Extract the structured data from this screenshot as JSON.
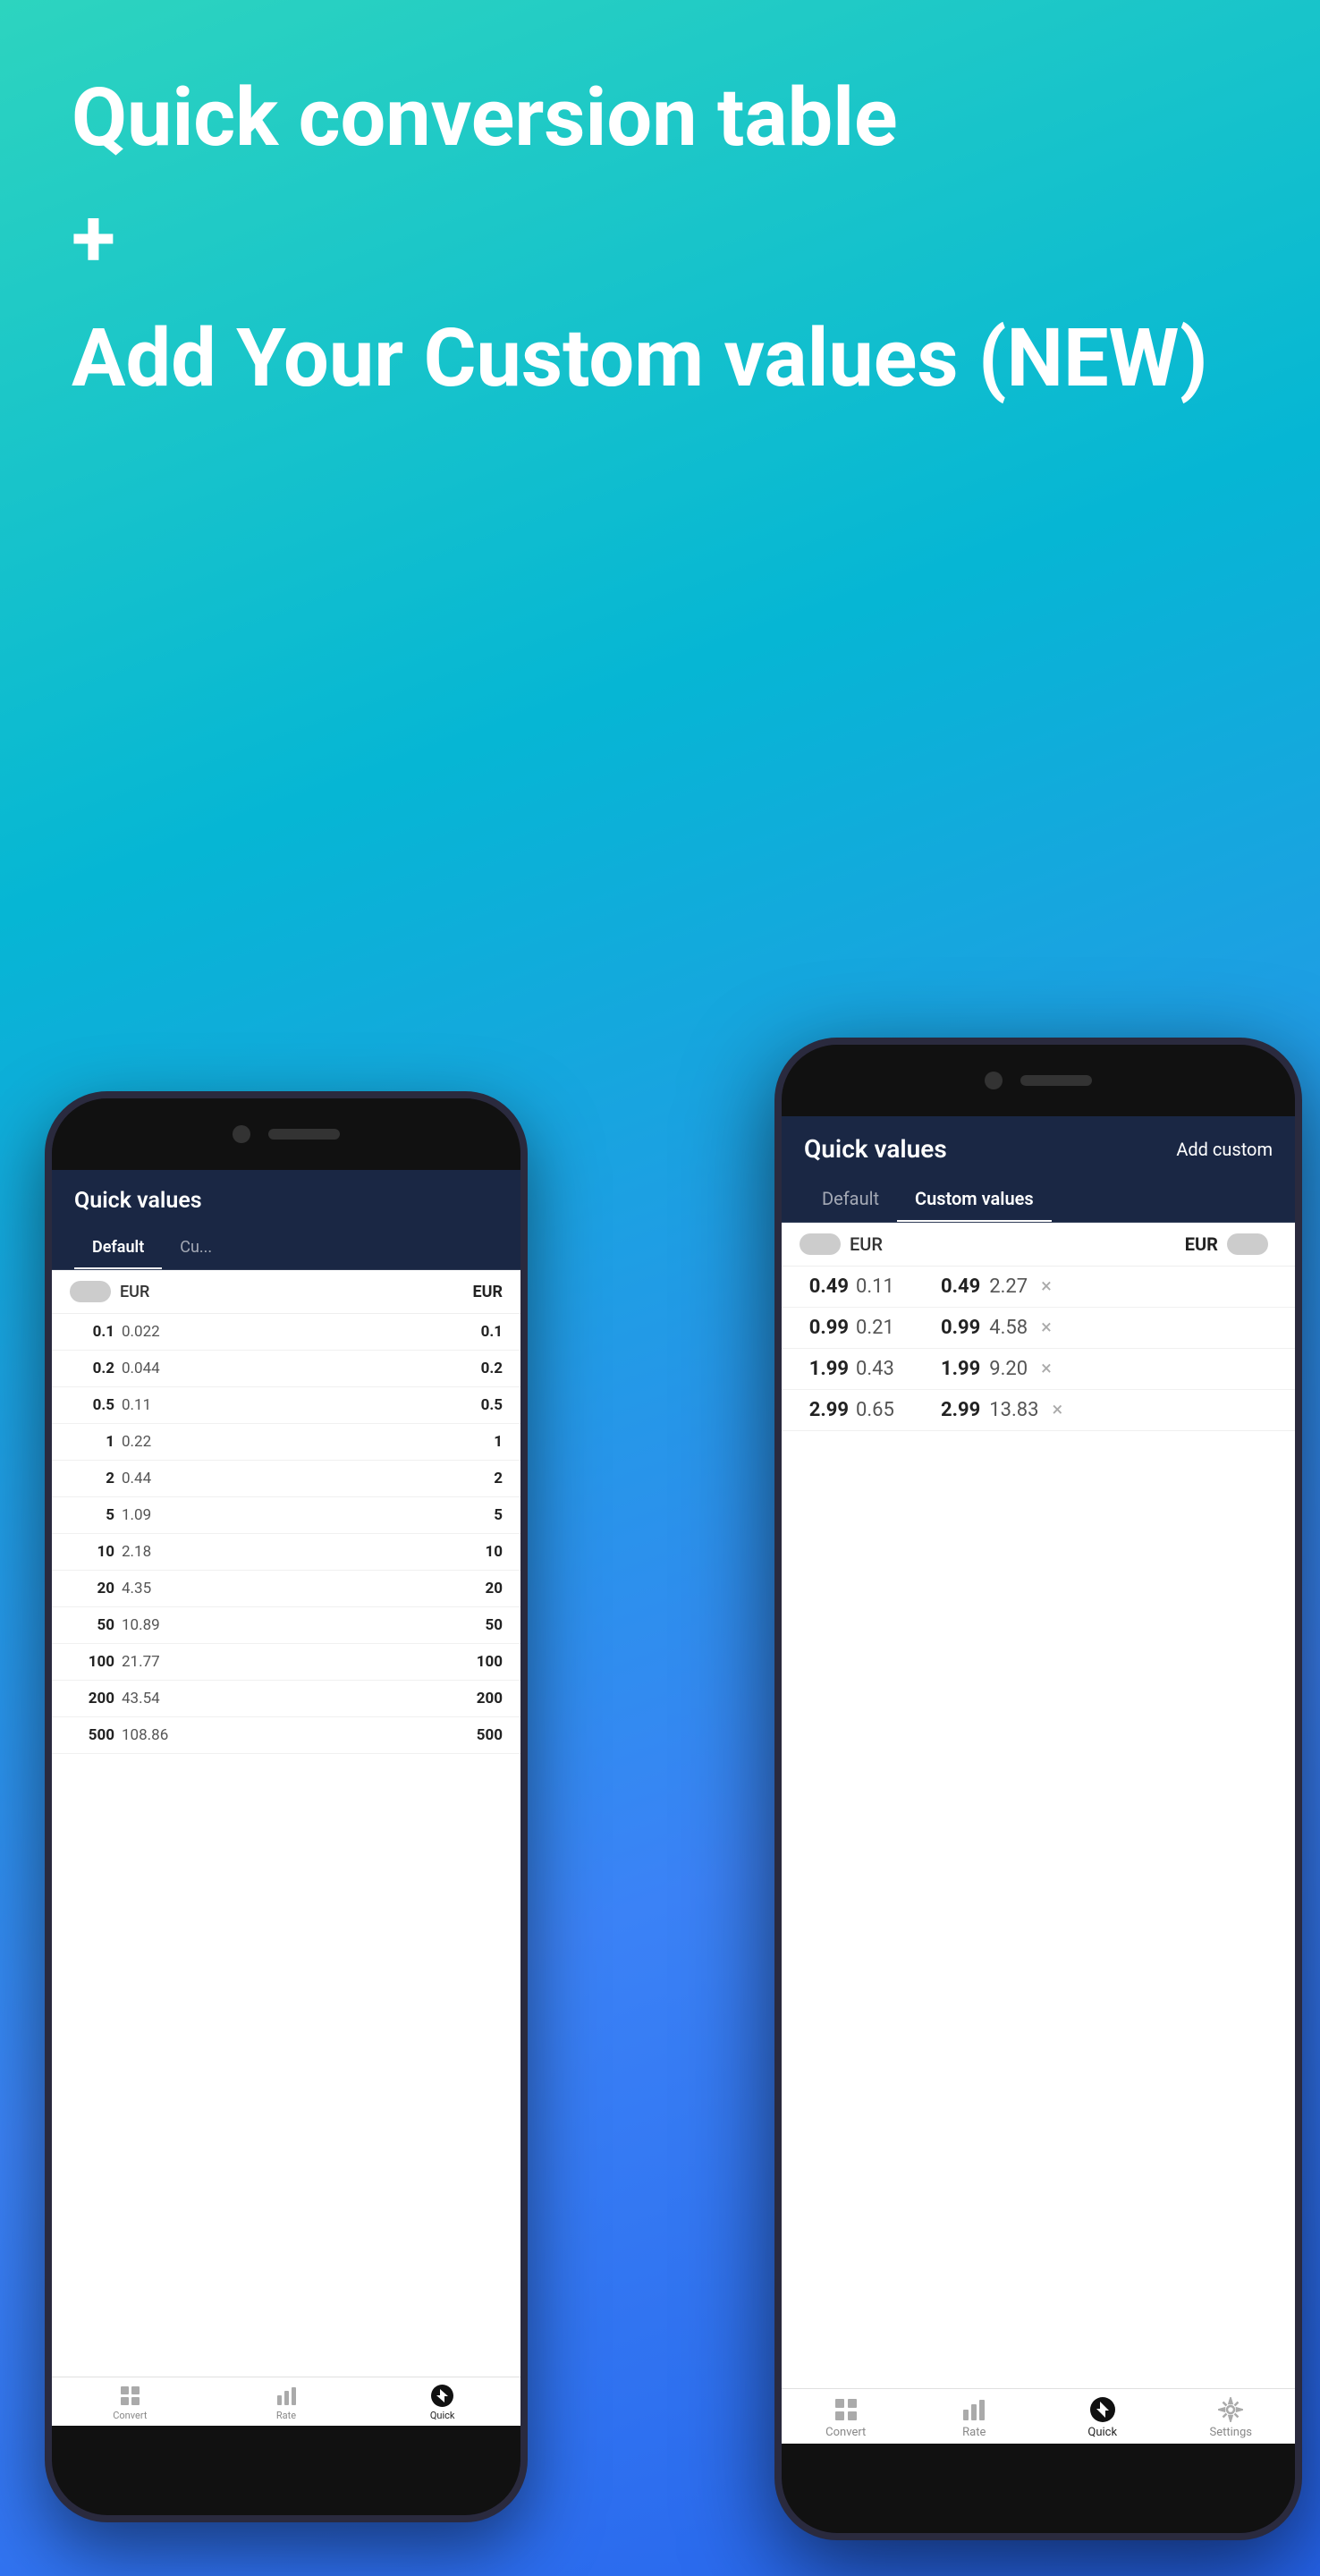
{
  "hero": {
    "title": "Quick conversion table",
    "plus": "+",
    "subtitle": "Add Your Custom values (NEW)"
  },
  "phone1": {
    "header": {
      "title": "Quick values"
    },
    "tabs": [
      {
        "label": "Default",
        "active": true
      },
      {
        "label": "Cu...",
        "active": false
      }
    ],
    "currency_toggle_left": "EUR",
    "currency_label_right": "EUR",
    "rows": [
      {
        "left": "0.1",
        "converted": "0.022",
        "right": "0.1"
      },
      {
        "left": "0.2",
        "converted": "0.044",
        "right": "0.2"
      },
      {
        "left": "0.5",
        "converted": "0.11",
        "right": "0.5"
      },
      {
        "left": "1",
        "converted": "0.22",
        "right": "1"
      },
      {
        "left": "2",
        "converted": "0.44",
        "right": "2"
      },
      {
        "left": "5",
        "converted": "1.09",
        "right": "5"
      },
      {
        "left": "10",
        "converted": "2.18",
        "right": "10"
      },
      {
        "left": "20",
        "converted": "4.35",
        "right": "20"
      },
      {
        "left": "50",
        "converted": "10.89",
        "right": "50"
      },
      {
        "left": "100",
        "converted": "21.77",
        "right": "100"
      },
      {
        "left": "200",
        "converted": "43.54",
        "right": "200"
      },
      {
        "left": "500",
        "converted": "108.86",
        "right": "500"
      }
    ],
    "nav": [
      {
        "label": "Convert",
        "icon": "grid-icon",
        "active": false
      },
      {
        "label": "Rate",
        "icon": "bar-chart-icon",
        "active": false
      },
      {
        "label": "Quick",
        "icon": "quick-icon",
        "active": true
      }
    ]
  },
  "phone2": {
    "header": {
      "title": "Quick values",
      "action": "Add custom"
    },
    "tabs": [
      {
        "label": "Default",
        "active": false
      },
      {
        "label": "Custom values",
        "active": true
      }
    ],
    "currency_toggle_left": "EUR",
    "currency_label_right": "EUR",
    "default_rows": [
      {
        "left": "0.49",
        "converted": "0.11",
        "right": "0.49",
        "right_val": "2.27"
      },
      {
        "left": "0.99",
        "converted": "0.21",
        "right": "0.99",
        "right_val": "4.58"
      },
      {
        "left": "1.99",
        "converted": "0.43",
        "right": "1.99",
        "right_val": "9.20"
      },
      {
        "left": "2.99",
        "converted": "0.65",
        "right": "2.99",
        "right_val": "13.83"
      }
    ],
    "nav": [
      {
        "label": "Convert",
        "icon": "grid-icon",
        "active": false
      },
      {
        "label": "Rate",
        "icon": "bar-chart-icon",
        "active": false
      },
      {
        "label": "Quick",
        "icon": "quick-icon",
        "active": true
      },
      {
        "label": "Settings",
        "icon": "gear-icon",
        "active": false
      }
    ]
  }
}
